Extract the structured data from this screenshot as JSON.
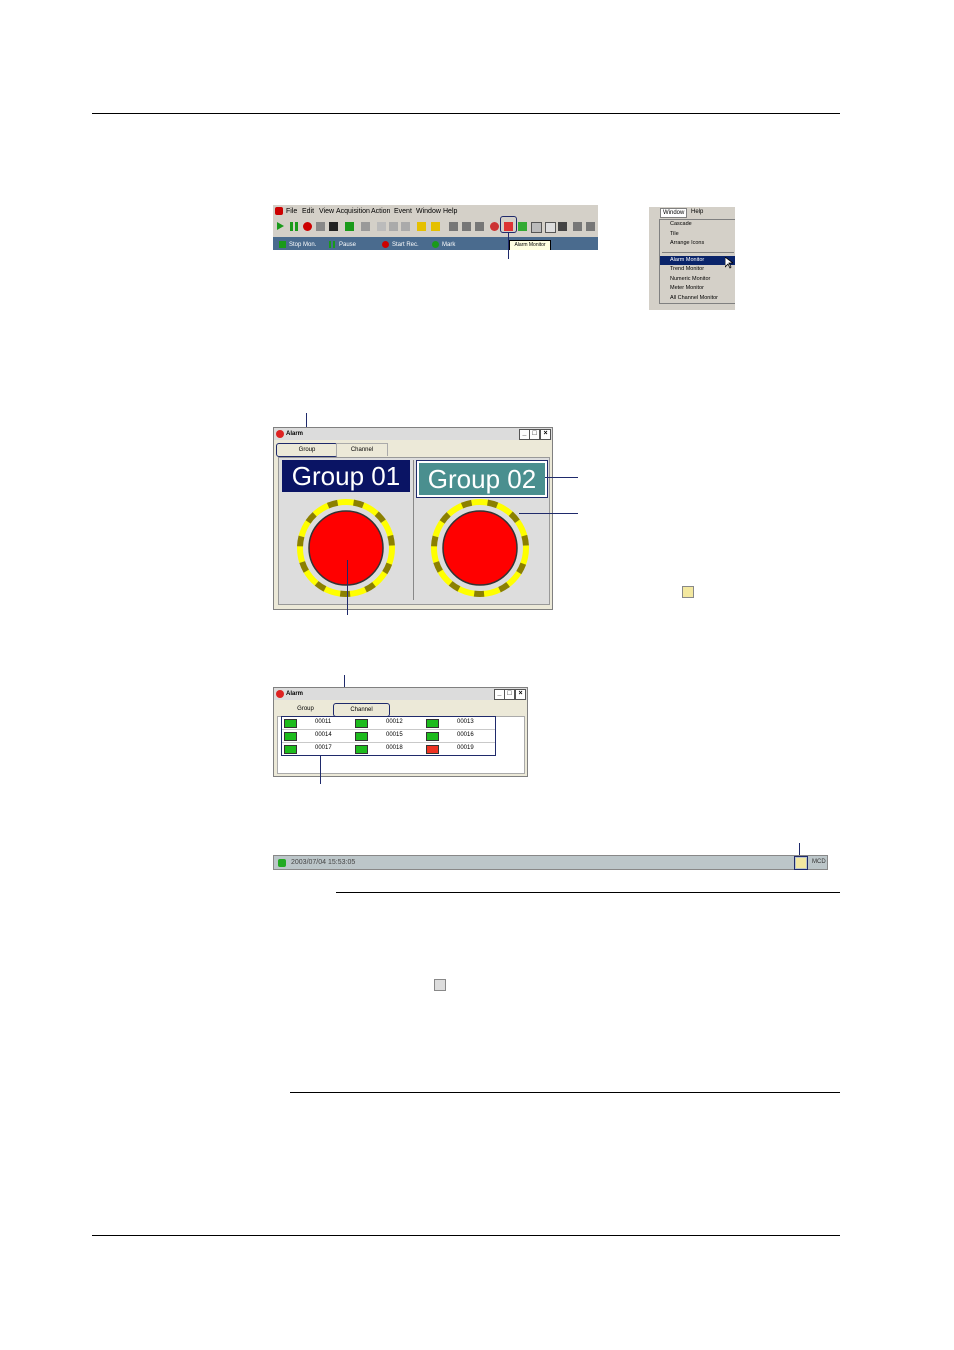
{
  "toolbar_shot": {
    "menu": [
      "File",
      "Edit",
      "View",
      "Acquisition",
      "Action",
      "Event",
      "Window",
      "Help"
    ],
    "actions": {
      "stop_mon": "Stop Mon.",
      "pause": "Pause",
      "start_rec": "Start Rec.",
      "mark": "Mark"
    },
    "tooltip": "Alarm Monitor"
  },
  "window_menu": {
    "bar": [
      "Window",
      "Help"
    ],
    "items": [
      "Cascade",
      "Tile",
      "Arrange Icons",
      "Alarm Monitor",
      "Trend Monitor",
      "Numeric Monitor",
      "Meter Monitor",
      "All Channel Monitor"
    ],
    "selected": "Alarm Monitor"
  },
  "alarm_group_window": {
    "title": "Alarm",
    "tabs": [
      "Group",
      "Channel"
    ],
    "groups": [
      "Group 01",
      "Group 02"
    ]
  },
  "alarm_channel_window": {
    "title": "Alarm",
    "tabs": [
      "Group",
      "Channel"
    ],
    "channels": [
      [
        {
          "id": "00011",
          "state": "ok"
        },
        {
          "id": "00012",
          "state": "ok"
        },
        {
          "id": "00013",
          "state": "ok"
        }
      ],
      [
        {
          "id": "00014",
          "state": "ok"
        },
        {
          "id": "00015",
          "state": "ok"
        },
        {
          "id": "00016",
          "state": "ok"
        }
      ],
      [
        {
          "id": "00017",
          "state": "ok"
        },
        {
          "id": "00018",
          "state": "ok"
        },
        {
          "id": "00019",
          "state": "alarm"
        }
      ]
    ]
  },
  "status_bar": {
    "datetime": "2003/07/04 15:53:05",
    "remark": "MCD"
  },
  "colors": {
    "callout": "#1f2a6b",
    "group01_bg": "#0a1464",
    "group02_bg": "#4a8f8f",
    "lamp_red": "#ff0000",
    "ring_yellow": "#ffff00",
    "ring_olive": "#8b8000"
  }
}
